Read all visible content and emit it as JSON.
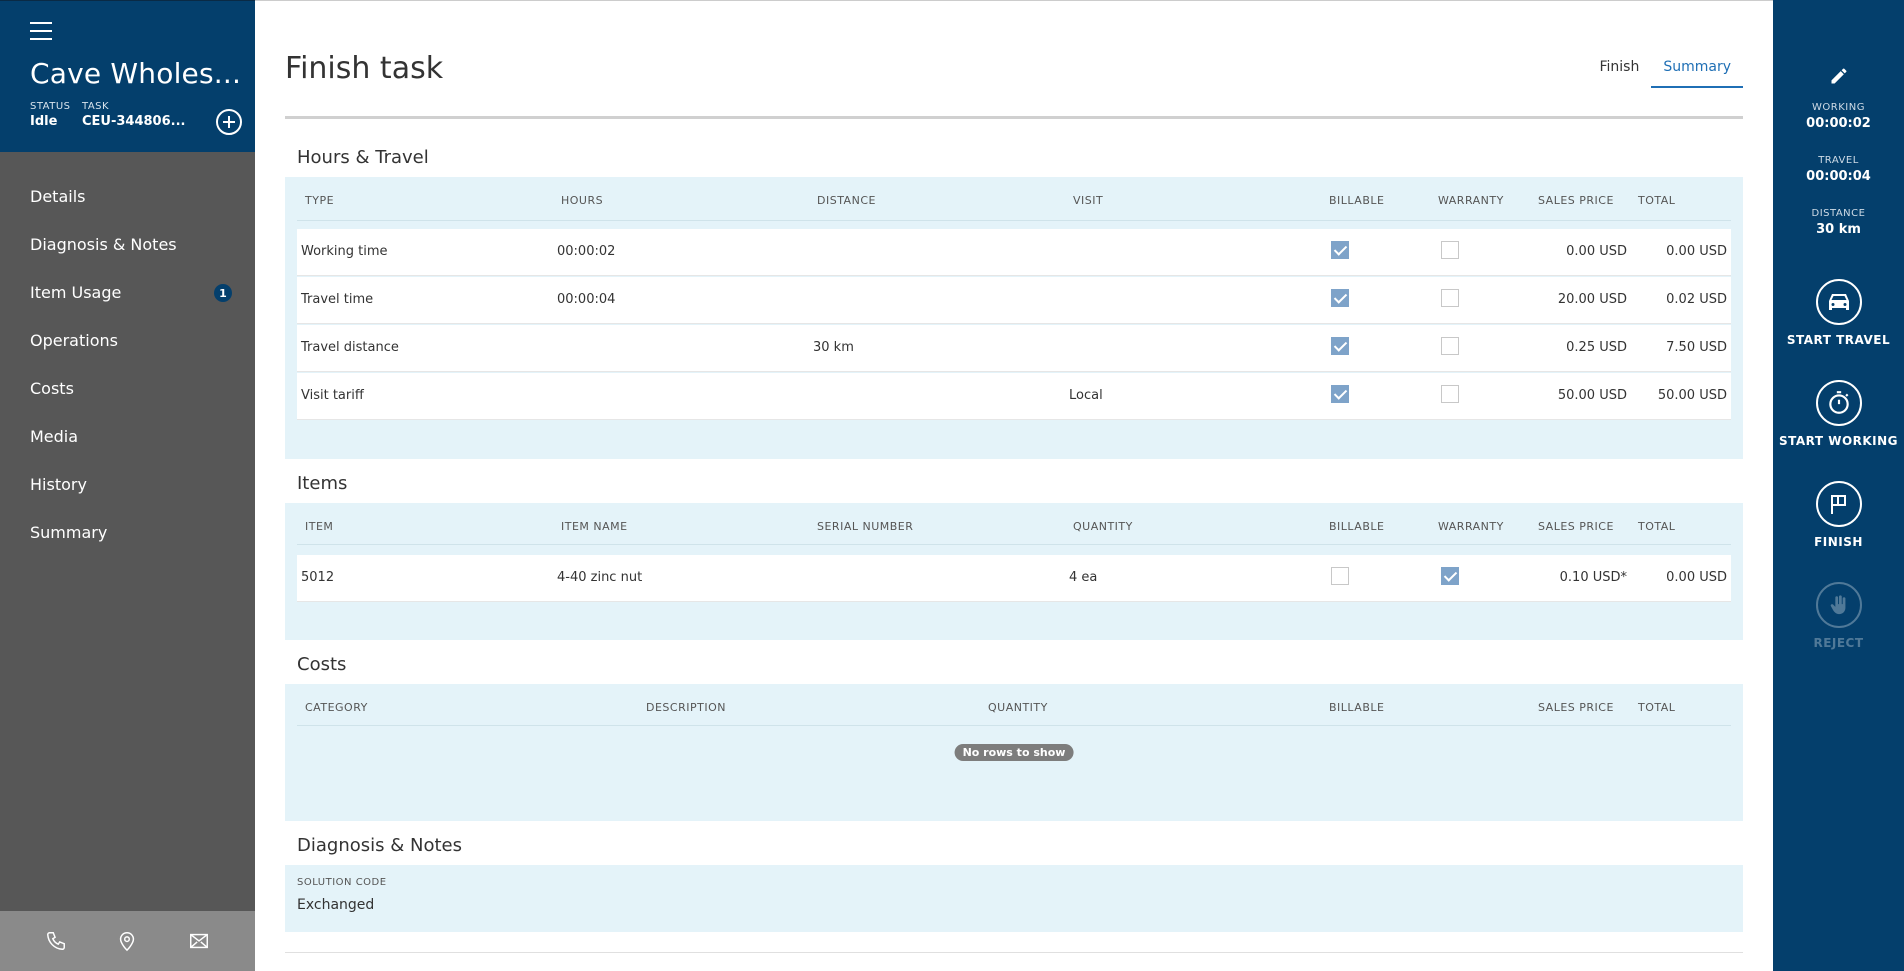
{
  "sidebar": {
    "title": "Cave Wholes...",
    "status_label": "STATUS",
    "status_value": "Idle",
    "task_label": "TASK",
    "task_value": "CEU-344806...",
    "nav": [
      {
        "label": "Details"
      },
      {
        "label": "Diagnosis & Notes"
      },
      {
        "label": "Item Usage",
        "badge": "1"
      },
      {
        "label": "Operations"
      },
      {
        "label": "Costs"
      },
      {
        "label": "Media"
      },
      {
        "label": "History"
      },
      {
        "label": "Summary"
      }
    ],
    "footer_icons": [
      "phone-icon",
      "location-pin-icon",
      "mail-icon"
    ]
  },
  "main": {
    "title": "Finish task",
    "tabs": [
      {
        "label": "Finish",
        "active": false
      },
      {
        "label": "Summary",
        "active": true
      }
    ]
  },
  "hours_travel": {
    "title": "Hours & Travel",
    "columns": [
      "TYPE",
      "HOURS",
      "DISTANCE",
      "VISIT",
      "BILLABLE",
      "WARRANTY",
      "SALES PRICE",
      "TOTAL"
    ],
    "rows": [
      {
        "type": "Working time",
        "hours": "00:00:02",
        "distance": "",
        "visit": "",
        "billable": true,
        "warranty": false,
        "sales_price": "0.00 USD",
        "total": "0.00 USD"
      },
      {
        "type": "Travel time",
        "hours": "00:00:04",
        "distance": "",
        "visit": "",
        "billable": true,
        "warranty": false,
        "sales_price": "20.00 USD",
        "total": "0.02 USD"
      },
      {
        "type": "Travel distance",
        "hours": "",
        "distance": "30 km",
        "visit": "",
        "billable": true,
        "warranty": false,
        "sales_price": "0.25 USD",
        "total": "7.50 USD"
      },
      {
        "type": "Visit tariff",
        "hours": "",
        "distance": "",
        "visit": "Local",
        "billable": true,
        "warranty": false,
        "sales_price": "50.00 USD",
        "total": "50.00 USD"
      }
    ]
  },
  "items": {
    "title": "Items",
    "columns": [
      "ITEM",
      "ITEM NAME",
      "SERIAL NUMBER",
      "QUANTITY",
      "BILLABLE",
      "WARRANTY",
      "SALES PRICE",
      "TOTAL"
    ],
    "rows": [
      {
        "item": "5012",
        "item_name": "4-40 zinc nut",
        "serial_number": "",
        "quantity": "4 ea",
        "billable": false,
        "warranty": true,
        "sales_price": "0.10 USD*",
        "total": "0.00 USD"
      }
    ]
  },
  "costs": {
    "title": "Costs",
    "columns": [
      "CATEGORY",
      "DESCRIPTION",
      "QUANTITY",
      "BILLABLE",
      "SALES PRICE",
      "TOTAL"
    ],
    "empty_text": "No rows to show"
  },
  "diagnosis": {
    "title": "Diagnosis & Notes",
    "solution_code_label": "SOLUTION CODE",
    "solution_code_value": "Exchanged"
  },
  "rightbar": {
    "working_label": "WORKING",
    "working_value": "00:00:02",
    "travel_label": "TRAVEL",
    "travel_value": "00:00:04",
    "distance_label": "DISTANCE",
    "distance_value": "30 km",
    "actions": [
      {
        "label": "START TRAVEL",
        "icon": "car-icon",
        "enabled": true
      },
      {
        "label": "START WORKING",
        "icon": "stopwatch-icon",
        "enabled": true
      },
      {
        "label": "FINISH",
        "icon": "flag-icon",
        "enabled": true
      },
      {
        "label": "REJECT",
        "icon": "hand-icon",
        "enabled": false
      }
    ]
  },
  "colors": {
    "brand_dark": "#043f6c",
    "sidebar_gray": "#575757",
    "panel_bg": "#e4f3f9",
    "accent_blue": "#1f6fb5",
    "checkbox_checked": "#7ea3c9"
  }
}
